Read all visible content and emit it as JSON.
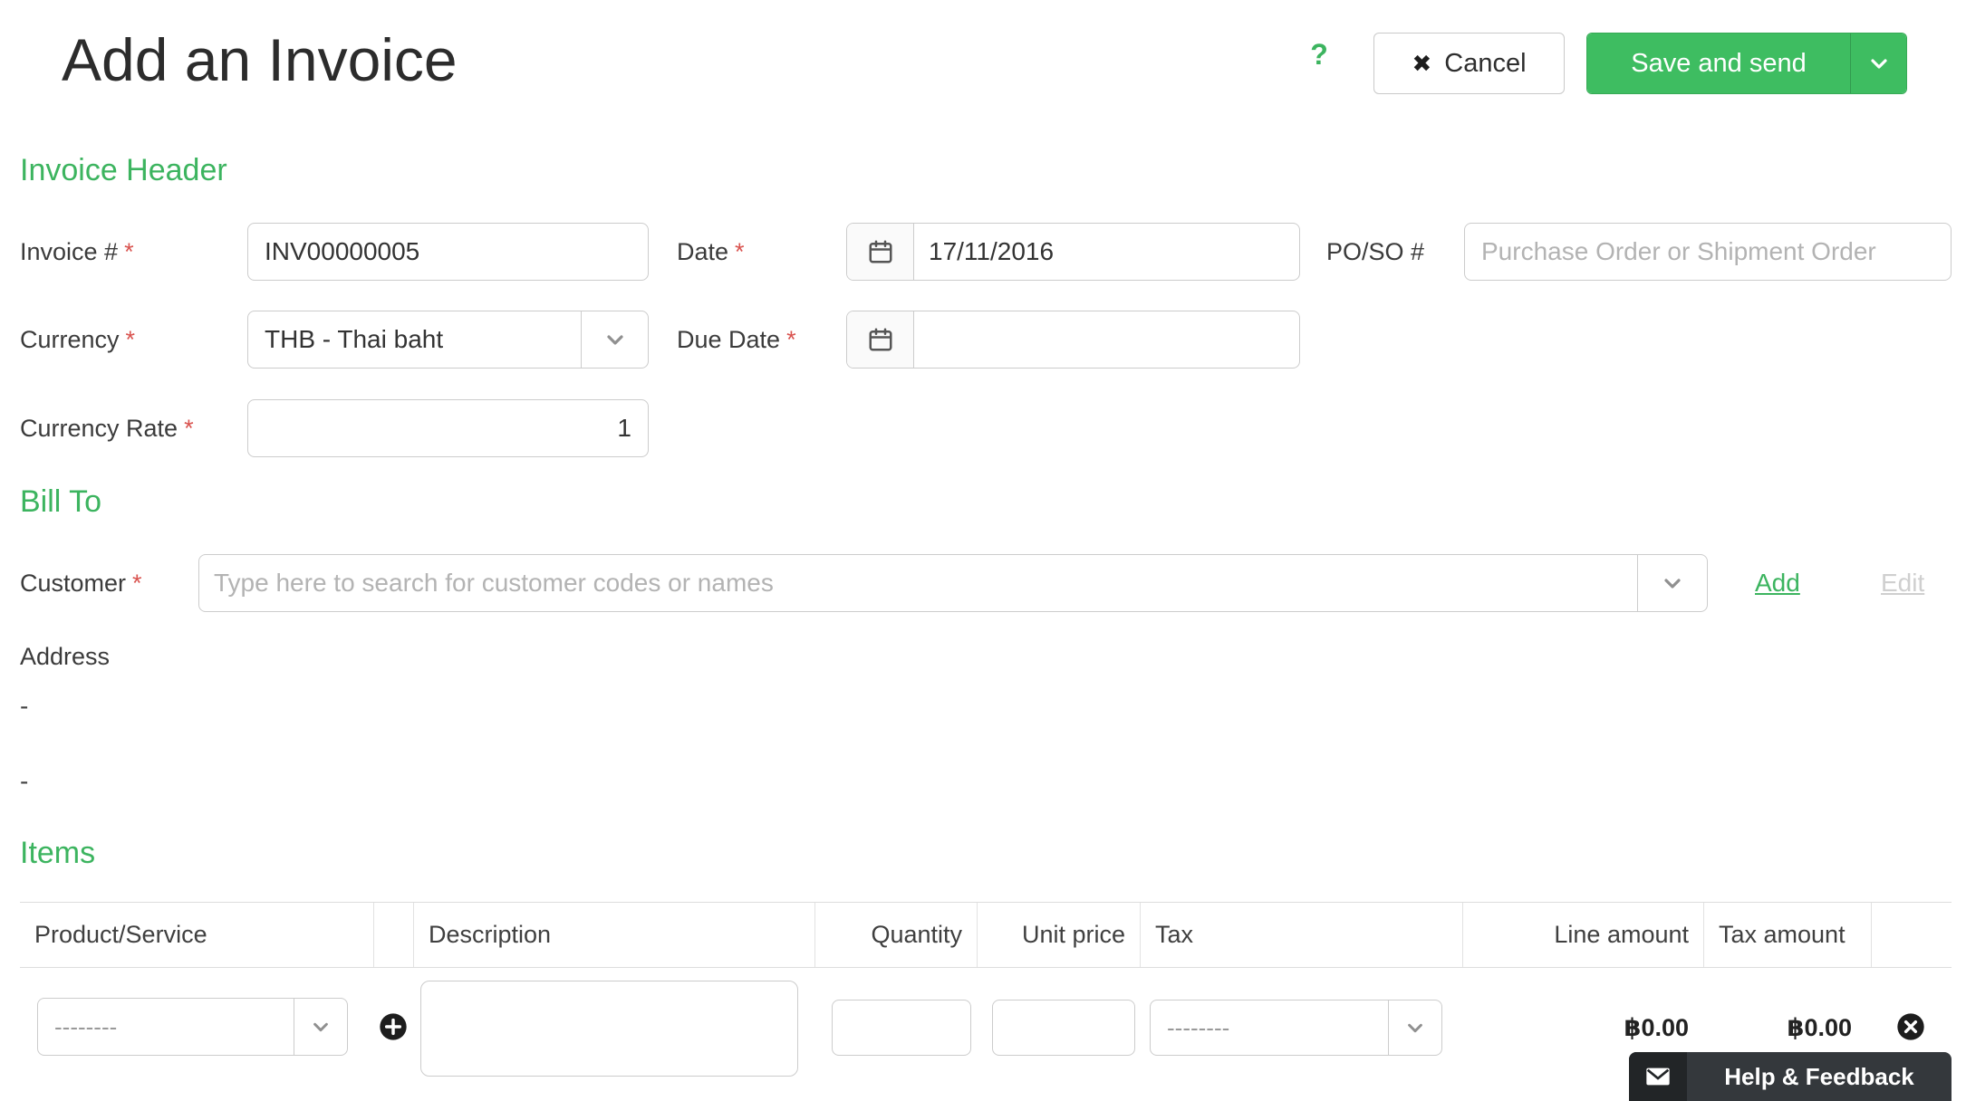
{
  "page": {
    "title": "Add an Invoice"
  },
  "toolbar": {
    "help_icon": "?",
    "cancel": {
      "icon": "✖",
      "label": "Cancel"
    },
    "save": {
      "label": "Save and send"
    }
  },
  "sections": {
    "invoice_header": "Invoice Header",
    "bill_to": "Bill To",
    "items": "Items"
  },
  "ui": {
    "required_mark": "*"
  },
  "fields": {
    "invoice_number": {
      "label": "Invoice #",
      "value": "INV00000005"
    },
    "date": {
      "label": "Date",
      "value": "17/11/2016"
    },
    "po_so": {
      "label": "PO/SO #",
      "placeholder": "Purchase Order or Shipment Order"
    },
    "currency": {
      "label": "Currency",
      "value": "THB - Thai baht"
    },
    "due_date": {
      "label": "Due Date",
      "value": ""
    },
    "currency_rate": {
      "label": "Currency Rate",
      "value": "1"
    },
    "customer": {
      "label": "Customer",
      "placeholder": "Type here to search for customer codes or names"
    },
    "address": {
      "label": "Address",
      "line1": "-",
      "line2": "-"
    }
  },
  "customer_actions": {
    "add": "Add",
    "edit": "Edit"
  },
  "items_table": {
    "columns": [
      "Product/Service",
      "",
      "Description",
      "Quantity",
      "Unit price",
      "Tax",
      "Line amount",
      "Tax amount",
      ""
    ],
    "row": {
      "product_placeholder": "--------",
      "description": "",
      "quantity": "",
      "unit_price": "",
      "tax_placeholder": "--------",
      "line_amount": "฿0.00",
      "tax_amount": "฿0.00"
    }
  },
  "footer": {
    "help_feedback": "Help & Feedback"
  },
  "colors": {
    "accent": "#3cb45f",
    "button": "#3ebd61",
    "button_border": "#37aa56",
    "required": "#d9534f",
    "muted_link": "#cfcfcf"
  }
}
